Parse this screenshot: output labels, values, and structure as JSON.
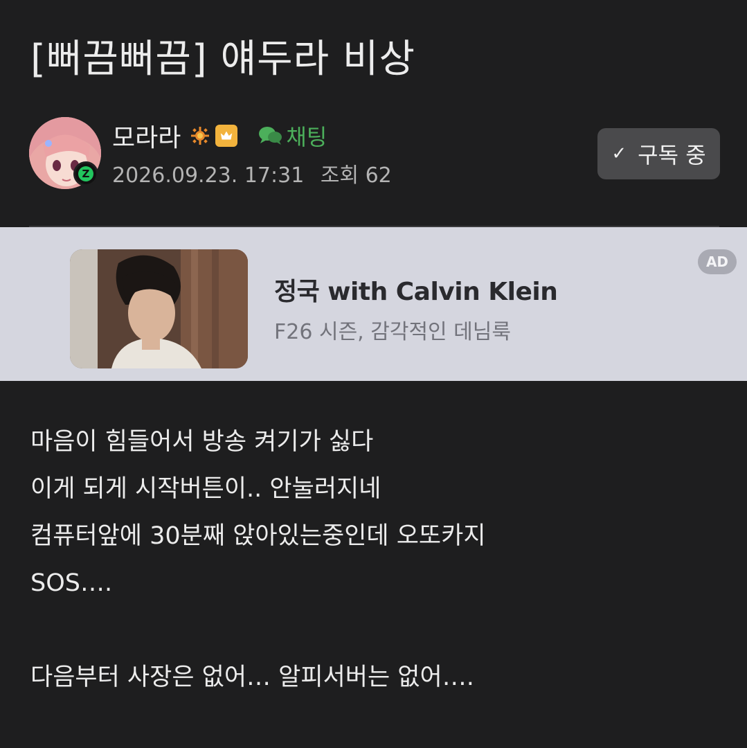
{
  "post": {
    "title": "[뻐끔뻐끔] 얘두라 비상",
    "author": "모라라",
    "chat_label": "채팅",
    "date": "2026.09.23. 17:31",
    "views": "조회 62",
    "subscribe_label": "구독 중"
  },
  "avatar_badge": "Z",
  "ad": {
    "title": "정국 with Calvin Klein",
    "subtitle": "F26 시즌, 감각적인 데님룩",
    "tag": "AD"
  },
  "content": {
    "lines": [
      "마음이 힘들어서 방송 켜기가 싫다",
      "이게 되게 시작버튼이.. 안눌러지네",
      "컴퓨터앞에 30분째 앉아있는중인데 오또카지",
      "SOS….",
      "",
      "다음부터 사장은 없어… 알피서버는 없어…."
    ]
  },
  "colors": {
    "background": "#1e1e1f",
    "accent_green": "#4caf5b",
    "ad_background": "#d5d6df",
    "button_bg": "#4a4a4c"
  },
  "icons": [
    "sun-icon",
    "crown-icon",
    "chat-bubble-icon",
    "check-icon"
  ]
}
